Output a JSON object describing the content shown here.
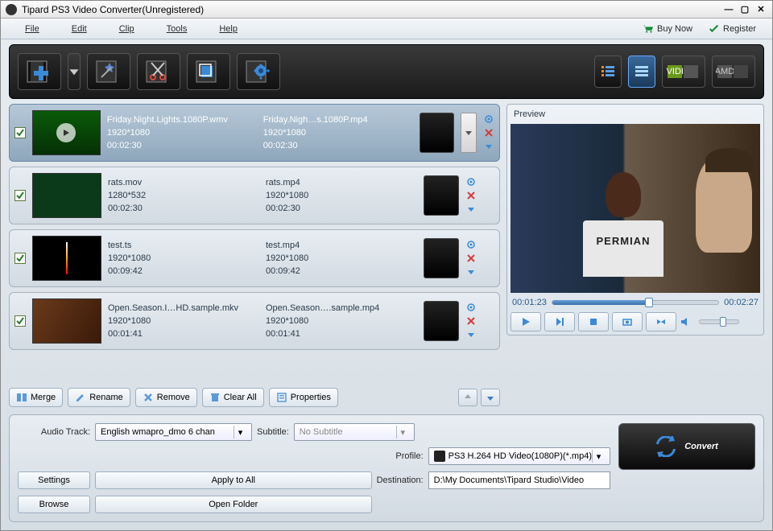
{
  "titlebar": {
    "title": "Tipard PS3 Video Converter(Unregistered)"
  },
  "menu": {
    "items": [
      "File",
      "Edit",
      "Clip",
      "Tools",
      "Help"
    ],
    "buy": "Buy Now",
    "register": "Register"
  },
  "files": [
    {
      "checked": true,
      "src_name": "Friday.Night.Lights.1080P.wmv",
      "src_res": "1920*1080",
      "src_dur": "00:02:30",
      "dst_name": "Friday.Nigh…s.1080P.mp4",
      "dst_res": "1920*1080",
      "dst_dur": "00:02:30",
      "selected": true
    },
    {
      "checked": true,
      "src_name": "rats.mov",
      "src_res": "1280*532",
      "src_dur": "00:02:30",
      "dst_name": "rats.mp4",
      "dst_res": "1920*1080",
      "dst_dur": "00:02:30",
      "selected": false
    },
    {
      "checked": true,
      "src_name": "test.ts",
      "src_res": "1920*1080",
      "src_dur": "00:09:42",
      "dst_name": "test.mp4",
      "dst_res": "1920*1080",
      "dst_dur": "00:09:42",
      "selected": false
    },
    {
      "checked": true,
      "src_name": "Open.Season.I…HD.sample.mkv",
      "src_res": "1920*1080",
      "src_dur": "00:01:41",
      "dst_name": "Open.Season….sample.mp4",
      "dst_res": "1920*1080",
      "dst_dur": "00:01:41",
      "selected": false
    }
  ],
  "actions": {
    "merge": "Merge",
    "rename": "Rename",
    "remove": "Remove",
    "clear_all": "Clear All",
    "properties": "Properties"
  },
  "preview": {
    "label": "Preview",
    "current": "00:01:23",
    "total": "00:02:27",
    "jersey": "PERMIAN"
  },
  "form": {
    "audio_label": "Audio Track:",
    "audio_value": "English wmapro_dmo 6 chan",
    "subtitle_label": "Subtitle:",
    "subtitle_value": "No Subtitle",
    "profile_label": "Profile:",
    "profile_value": "PS3 H.264 HD Video(1080P)(*.mp4)",
    "settings": "Settings",
    "apply_all": "Apply to All",
    "dest_label": "Destination:",
    "dest_value": "D:\\My Documents\\Tipard Studio\\Video",
    "browse": "Browse",
    "open_folder": "Open Folder"
  },
  "convert": "Convert",
  "gpu": {
    "nvidia": "NVIDIA",
    "amd": "AMD"
  }
}
